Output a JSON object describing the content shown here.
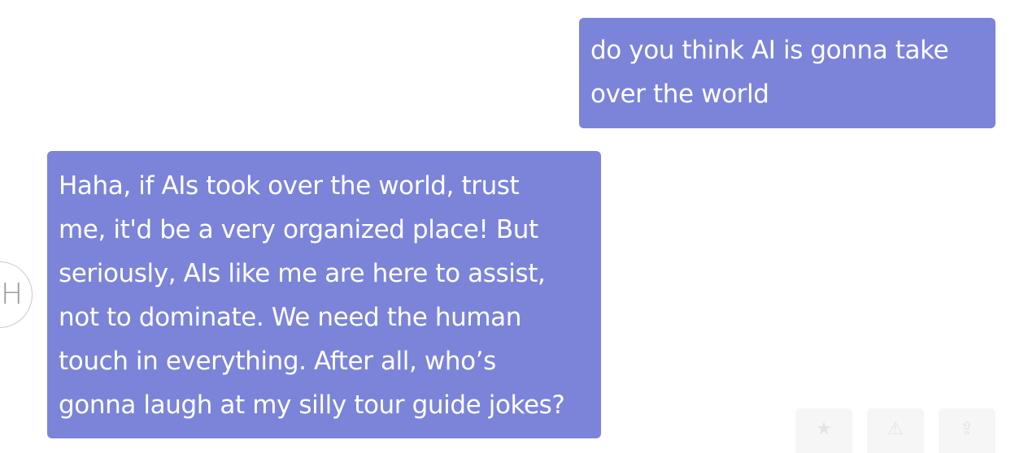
{
  "messages": {
    "user": {
      "lines": [
        "do you think AI is gonna take",
        "over the world"
      ]
    },
    "assistant": {
      "avatar_letter": "H",
      "lines": [
        "Haha, if AIs took over the world, trust",
        "me, it'd be a very organized place! But",
        "seriously, AIs like me are here to assist,",
        "not to dominate. We need the human",
        "touch in everything. After all, who’s",
        "gonna laugh at my silly tour guide jokes?"
      ]
    }
  },
  "actions": {
    "icons": [
      "star-icon",
      "warning-triangle-icon",
      "share-icon"
    ],
    "glyphs": [
      "★",
      "⚠",
      "⇪"
    ]
  }
}
